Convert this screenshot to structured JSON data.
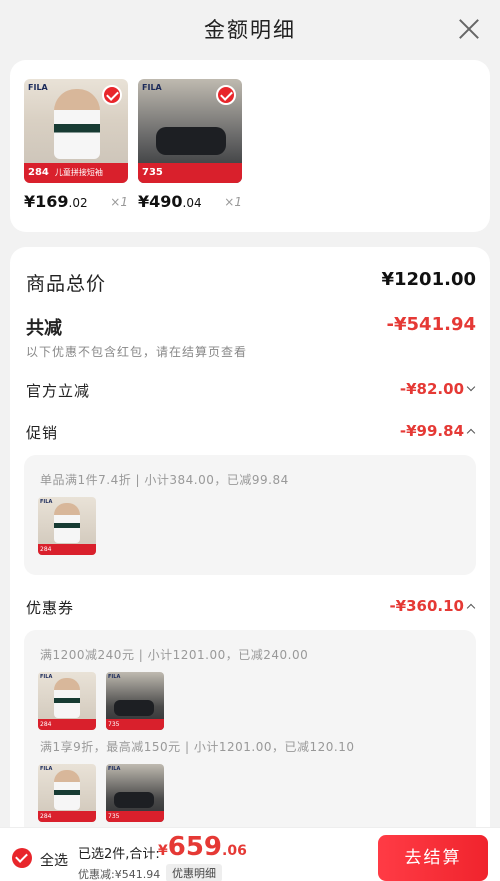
{
  "header": {
    "title": "金额明细",
    "close_icon": "close-icon"
  },
  "products": [
    {
      "brand": "FILA",
      "badge": "284",
      "strip_text": "儿童拼接短袖",
      "price_main": "¥169",
      "price_dec": ".02",
      "qty": "×1",
      "selected": true
    },
    {
      "brand": "FILA",
      "badge": "735",
      "strip_text": "",
      "price_main": "¥490",
      "price_dec": ".04",
      "qty": "×1",
      "selected": true
    }
  ],
  "details": {
    "total_label": "商品总价",
    "total_value": "¥1201.00",
    "discount_label": "共减",
    "discount_value": "-¥541.94",
    "note": "以下优惠不包含红包，请在结算页查看",
    "official_label": "官方立减",
    "official_value": "-¥82.00",
    "promo_label": "促销",
    "promo_value": "-¥99.84",
    "promo_detail": "单品满1件7.4折 | 小计384.00，已减99.84",
    "coupon_label": "优惠券",
    "coupon_value": "-¥360.10",
    "coupon_detail_1": "满1200减240元 | 小计1201.00，已减240.00",
    "coupon_detail_2": "满1享9折，最高减150元 | 小计1201.00，已减120.10"
  },
  "thumb_badges": {
    "a": "284",
    "b": "735",
    "brand": "FILA"
  },
  "footer": {
    "select_all": "全选",
    "summary": "已选2件,合计:",
    "price_yen": "¥",
    "price_main": "659",
    "price_dec": ".06",
    "saved": "优惠减:¥541.94",
    "detail_tag": "优惠明细",
    "checkout": "去结算"
  },
  "colors": {
    "accent": "#e53935",
    "checkout": "#f0242d",
    "background": "#f2f2f2"
  }
}
